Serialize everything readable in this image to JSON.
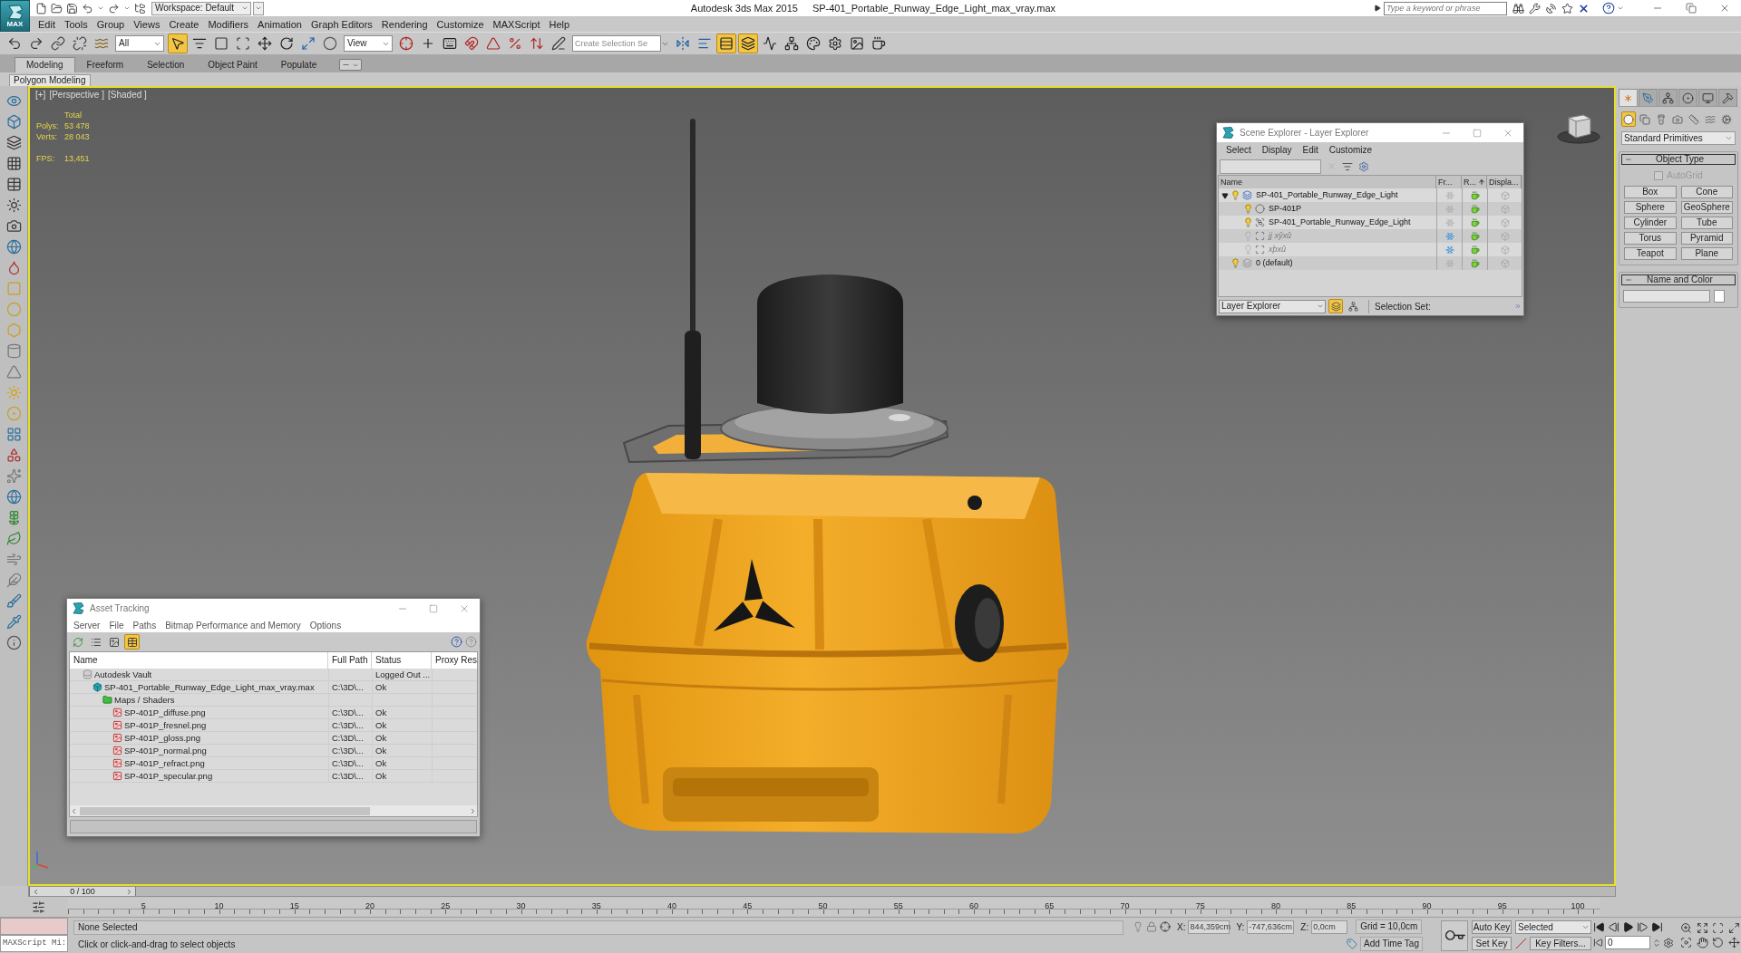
{
  "title_bar": {
    "app_button": "MAX",
    "workspace": "Workspace: Default",
    "app_name": "Autodesk 3ds Max 2015",
    "file_name": "SP-401_Portable_Runway_Edge_Light_max_vray.max",
    "search": {
      "placeholder": "Type a keyword or phrase"
    }
  },
  "menu_bar": [
    "Edit",
    "Tools",
    "Group",
    "Views",
    "Create",
    "Modifiers",
    "Animation",
    "Graph Editors",
    "Rendering",
    "Customize",
    "MAXScript",
    "Help"
  ],
  "main_toolbar": [
    {
      "kind": "undo",
      "on": false
    },
    {
      "kind": "redo",
      "on": false
    },
    {
      "kind": "link",
      "on": false
    },
    {
      "kind": "unlink",
      "on": false
    },
    {
      "kind": "bind",
      "on": false
    },
    {
      "kind": "dropdown",
      "value": "All"
    },
    {
      "kind": "select",
      "on": true
    },
    {
      "kind": "selectname",
      "on": false
    },
    {
      "kind": "region",
      "on": false
    },
    {
      "kind": "crossing",
      "on": false
    },
    {
      "kind": "move",
      "on": false
    },
    {
      "kind": "rotate",
      "on": false
    },
    {
      "kind": "scale",
      "on": false
    },
    {
      "kind": "manipulate",
      "on": false
    },
    {
      "kind": "dropdown",
      "value": "View"
    },
    {
      "kind": "pivot",
      "on": false
    },
    {
      "kind": "gizmo",
      "on": false
    },
    {
      "kind": "keyboard",
      "on": false
    },
    {
      "kind": "snap",
      "on": false
    },
    {
      "kind": "anglesnap",
      "on": false
    },
    {
      "kind": "percentsnap",
      "on": false
    },
    {
      "kind": "spinnersnap",
      "on": false
    },
    {
      "kind": "editsets",
      "on": false
    },
    {
      "kind": "combo",
      "placeholder": "Create Selection Se"
    },
    {
      "kind": "mirror",
      "on": false
    },
    {
      "kind": "align",
      "on": false
    },
    {
      "kind": "explorer",
      "on": true
    },
    {
      "kind": "layers",
      "on": true
    },
    {
      "kind": "curves",
      "on": false
    },
    {
      "kind": "schematic",
      "on": false
    },
    {
      "kind": "material",
      "on": false
    },
    {
      "kind": "setup",
      "on": false
    },
    {
      "kind": "framebuffer",
      "on": false
    },
    {
      "kind": "render",
      "on": false
    }
  ],
  "ribbon": {
    "tabs": [
      {
        "label": "Modeling",
        "selected": true
      },
      {
        "label": "Freeform",
        "selected": false
      },
      {
        "label": "Selection",
        "selected": false
      },
      {
        "label": "Object Paint",
        "selected": false
      },
      {
        "label": "Populate",
        "selected": false
      }
    ],
    "panel_tab": "Polygon Modeling"
  },
  "viewport": {
    "labels": [
      "[+]",
      "[Perspective ]",
      "[Shaded ]"
    ],
    "stats": {
      "heading": "Total",
      "rows": [
        {
          "label": "Polys:",
          "value": "53 478"
        },
        {
          "label": "Verts:",
          "value": "28 043"
        }
      ]
    },
    "fps": {
      "label": "FPS:",
      "value": "13,451"
    }
  },
  "scene_explorer": {
    "title": "Scene Explorer - Layer Explorer",
    "menus": [
      "Select",
      "Display",
      "Edit",
      "Customize"
    ],
    "columns": [
      "Name",
      "Fr...",
      "R...",
      "Displa..."
    ],
    "tree": [
      {
        "name": "SP-401_Portable_Runway_Edge_Light",
        "kind": "layer",
        "current": true,
        "expanded": true,
        "hidden": false,
        "frozen": false,
        "children": [
          {
            "name": "SP-401P",
            "kind": "geometry",
            "hidden": false,
            "frozen": false
          },
          {
            "name": "SP-401_Portable_Runway_Edge_Light",
            "kind": "group",
            "hidden": false,
            "frozen": false
          },
          {
            "name": "jj xŷxû",
            "kind": "helper",
            "hidden": true,
            "frozen": true
          },
          {
            "name": "xþxû",
            "kind": "helper",
            "hidden": true,
            "frozen": true
          }
        ]
      },
      {
        "name": "0 (default)",
        "kind": "layer",
        "current": false,
        "hidden": false,
        "frozen": false
      }
    ],
    "footer": {
      "mode": "Layer Explorer",
      "views": [
        {
          "kind": "layers",
          "selected": true
        },
        {
          "kind": "hierarchy",
          "selected": false
        }
      ],
      "selection_set": "Selection Set:"
    }
  },
  "asset_tracking": {
    "title": "Asset Tracking",
    "menus": [
      "Server",
      "File",
      "Paths",
      "Bitmap Performance and Memory",
      "Options"
    ],
    "tools": [
      {
        "kind": "refresh",
        "selected": false
      },
      {
        "kind": "list",
        "selected": false
      },
      {
        "kind": "thumbnail",
        "selected": false
      },
      {
        "kind": "table",
        "selected": true
      }
    ],
    "columns": [
      "Name",
      "Full Path",
      "Status",
      "Proxy Res"
    ],
    "rows": [
      {
        "name": "Autodesk Vault",
        "kind": "vault",
        "status": "Logged Out ...",
        "children": [
          {
            "name": "SP-401_Portable_Runway_Edge_Light_max_vray.max",
            "kind": "scene",
            "path": "C:\\3D\\...",
            "status": "Ok",
            "children": [
              {
                "name": "Maps / Shaders",
                "kind": "folder",
                "children": [
                  {
                    "name": "SP-401P_diffuse.png",
                    "kind": "bitmap",
                    "path": "C:\\3D\\...",
                    "status": "Ok"
                  },
                  {
                    "name": "SP-401P_fresnel.png",
                    "kind": "bitmap",
                    "path": "C:\\3D\\...",
                    "status": "Ok"
                  },
                  {
                    "name": "SP-401P_gloss.png",
                    "kind": "bitmap",
                    "path": "C:\\3D\\...",
                    "status": "Ok"
                  },
                  {
                    "name": "SP-401P_normal.png",
                    "kind": "bitmap",
                    "path": "C:\\3D\\...",
                    "status": "Ok"
                  },
                  {
                    "name": "SP-401P_refract.png",
                    "kind": "bitmap",
                    "path": "C:\\3D\\...",
                    "status": "Ok"
                  },
                  {
                    "name": "SP-401P_specular.png",
                    "kind": "bitmap",
                    "path": "C:\\3D\\...",
                    "status": "Ok"
                  }
                ]
              }
            ]
          }
        ]
      }
    ]
  },
  "command_panel": {
    "tabs": [
      {
        "kind": "create",
        "selected": true
      },
      {
        "kind": "modify",
        "selected": false
      },
      {
        "kind": "hierarchy",
        "selected": false
      },
      {
        "kind": "motion",
        "selected": false
      },
      {
        "kind": "display",
        "selected": false
      },
      {
        "kind": "utilities",
        "selected": false
      }
    ],
    "categories": [
      {
        "kind": "geometry",
        "selected": true
      },
      {
        "kind": "shapes",
        "selected": false
      },
      {
        "kind": "lights",
        "selected": false
      },
      {
        "kind": "cameras",
        "selected": false
      },
      {
        "kind": "helpers",
        "selected": false
      },
      {
        "kind": "spacewarps",
        "selected": false
      },
      {
        "kind": "systems",
        "selected": false
      }
    ],
    "type_list": "Standard Primitives",
    "object_type": {
      "title": "Object Type",
      "autogrid": {
        "label": "AutoGrid",
        "checked": false,
        "disabled": true
      },
      "buttons": [
        "Box",
        "Cone",
        "Sphere",
        "GeoSphere",
        "Cylinder",
        "Tube",
        "Torus",
        "Pyramid",
        "Teapot",
        "Plane"
      ]
    },
    "name_and_color": {
      "title": "Name and Color",
      "color": "#ffffff"
    }
  },
  "timeline": {
    "slider": {
      "label": "0 / 100",
      "level": 0
    },
    "ticks": [
      "5",
      "10",
      "15",
      "20",
      "25",
      "30",
      "35",
      "40",
      "45",
      "50",
      "55",
      "60",
      "65",
      "70",
      "75",
      "80",
      "85",
      "90",
      "95",
      "100"
    ]
  },
  "status_bar": {
    "listener": "MAXScript Mi:",
    "selection": "None Selected",
    "prompt": "Click or click-and-drag to select objects",
    "coords": [
      {
        "axis": "X:",
        "value": "844,359cm"
      },
      {
        "axis": "Y:",
        "value": "-747,636cm"
      },
      {
        "axis": "Z:",
        "value": "0,0cm"
      }
    ],
    "grid": "Grid = 10,0cm",
    "time_tag": "Add Time Tag",
    "auto_key": {
      "label": "Auto Key",
      "on": false
    },
    "key_mode": "Selected",
    "set_key": "Set Key",
    "key_filters": "Key Filters...",
    "frame": "0"
  }
}
